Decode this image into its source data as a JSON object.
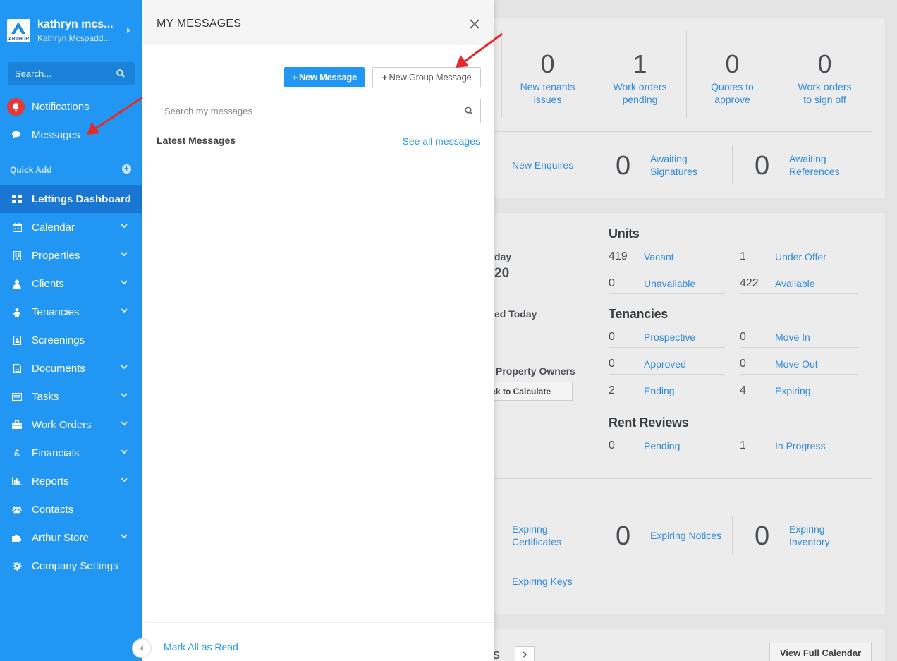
{
  "sidebar": {
    "profile": {
      "name": "kathryn mcs...",
      "subtitle": "Kathryn Mcspadd...",
      "logo_text": "ARTHUR"
    },
    "search_placeholder": "Search...",
    "notifications_label": "Notifications",
    "messages_label": "Messages",
    "quick_add_label": "Quick Add",
    "items": [
      {
        "label": "Lettings Dashboard",
        "icon": "dashboard-icon",
        "active": true,
        "has_chevron": false
      },
      {
        "label": "Calendar",
        "icon": "calendar-icon",
        "active": false,
        "has_chevron": true
      },
      {
        "label": "Properties",
        "icon": "building-icon",
        "active": false,
        "has_chevron": true
      },
      {
        "label": "Clients",
        "icon": "user-icon",
        "active": false,
        "has_chevron": true
      },
      {
        "label": "Tenancies",
        "icon": "tenant-icon",
        "active": false,
        "has_chevron": true
      },
      {
        "label": "Screenings",
        "icon": "id-card-icon",
        "active": false,
        "has_chevron": false
      },
      {
        "label": "Documents",
        "icon": "document-icon",
        "active": false,
        "has_chevron": true
      },
      {
        "label": "Tasks",
        "icon": "list-icon",
        "active": false,
        "has_chevron": true
      },
      {
        "label": "Work Orders",
        "icon": "briefcase-icon",
        "active": false,
        "has_chevron": true
      },
      {
        "label": "Financials",
        "icon": "pound-icon",
        "active": false,
        "has_chevron": true
      },
      {
        "label": "Reports",
        "icon": "bar-chart-icon",
        "active": false,
        "has_chevron": true
      },
      {
        "label": "Contacts",
        "icon": "users-icon",
        "active": false,
        "has_chevron": false
      },
      {
        "label": "Arthur Store",
        "icon": "puzzle-icon",
        "active": false,
        "has_chevron": true
      },
      {
        "label": "Company Settings",
        "icon": "gear-icon",
        "active": false,
        "has_chevron": false
      }
    ]
  },
  "messages_panel": {
    "title": "MY MESSAGES",
    "new_message_label": "New Message",
    "new_group_message_label": "New Group Message",
    "search_placeholder": "Search my messages",
    "latest_heading": "Latest Messages",
    "see_all_label": "See all messages",
    "mark_all_label": "Mark All as Read"
  },
  "dashboard": {
    "top_stats": [
      {
        "value": "0",
        "label_line1": "New tenants",
        "label_line2": "issues"
      },
      {
        "value": "1",
        "label_line1": "Work orders",
        "label_line2": "pending"
      },
      {
        "value": "0",
        "label_line1": "Quotes to",
        "label_line2": "approve"
      },
      {
        "value": "0",
        "label_line1": "Work orders",
        "label_line2": "to sign off"
      }
    ],
    "second_row": {
      "new_enquires": "New Enquires",
      "awaiting_signatures": {
        "value": "0",
        "line1": "Awaiting",
        "line2": "Signatures"
      },
      "awaiting_references": {
        "value": "0",
        "line1": "Awaiting",
        "line2": "References"
      }
    },
    "partial_text": {
      "today_fragment": "day",
      "amount_fragment": "20",
      "updated_fragment": "ed Today",
      "owners_fragment": "Property Owners",
      "calculate_button": "ck to Calculate",
      "bottom_fragment": "s"
    },
    "units": {
      "heading": "Units",
      "rows": [
        {
          "n1": "419",
          "l1": "Vacant",
          "n2": "1",
          "l2": "Under Offer"
        },
        {
          "n1": "0",
          "l1": "Unavailable",
          "n2": "422",
          "l2": "Available"
        }
      ]
    },
    "tenancies": {
      "heading": "Tenancies",
      "rows": [
        {
          "n1": "0",
          "l1": "Prospective",
          "n2": "0",
          "l2": "Move In"
        },
        {
          "n1": "0",
          "l1": "Approved",
          "n2": "0",
          "l2": "Move Out"
        },
        {
          "n1": "2",
          "l1": "Ending",
          "n2": "4",
          "l2": "Expiring"
        }
      ]
    },
    "rent_reviews": {
      "heading": "Rent Reviews",
      "rows": [
        {
          "n1": "0",
          "l1": "Pending",
          "n2": "1",
          "l2": "In Progress"
        }
      ]
    },
    "expiring": {
      "certificates_line1": "Expiring",
      "certificates_line2": "Certificates",
      "notices": {
        "value": "0",
        "label": "Expiring Notices"
      },
      "inventory": {
        "value": "0",
        "line1": "Expiring",
        "line2": "Inventory"
      },
      "keys": "Expiring Keys"
    },
    "view_full_calendar": "View Full Calendar"
  },
  "colors": {
    "sidebar": "#2196f3",
    "sidebar_active": "#1976d2",
    "link": "#2f8ad8",
    "annotation_arrow": "#e32b2b"
  }
}
